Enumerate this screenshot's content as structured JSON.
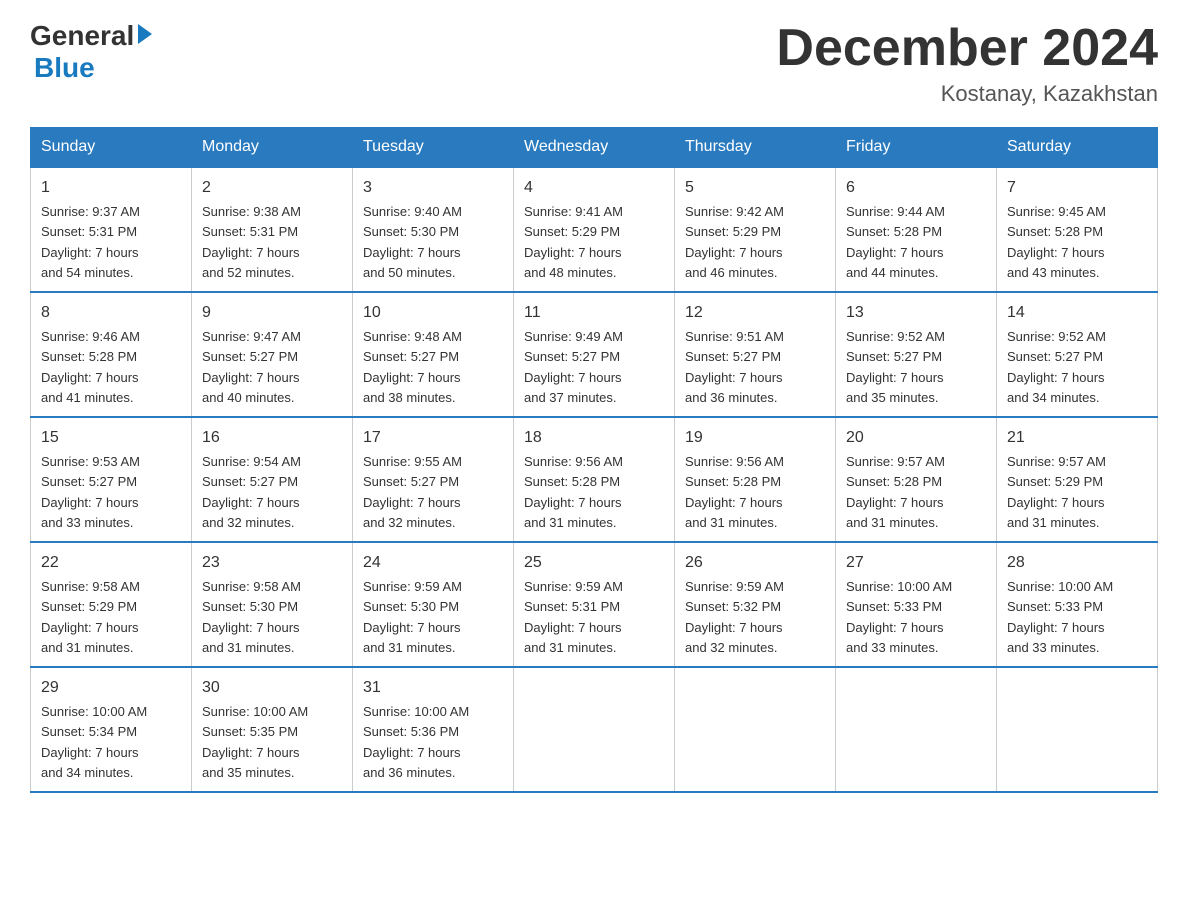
{
  "header": {
    "logo_general": "General",
    "logo_blue": "Blue",
    "month_title": "December 2024",
    "location": "Kostanay, Kazakhstan"
  },
  "days_of_week": [
    "Sunday",
    "Monday",
    "Tuesday",
    "Wednesday",
    "Thursday",
    "Friday",
    "Saturday"
  ],
  "weeks": [
    [
      {
        "day": "1",
        "sunrise": "9:37 AM",
        "sunset": "5:31 PM",
        "daylight": "7 hours and 54 minutes."
      },
      {
        "day": "2",
        "sunrise": "9:38 AM",
        "sunset": "5:31 PM",
        "daylight": "7 hours and 52 minutes."
      },
      {
        "day": "3",
        "sunrise": "9:40 AM",
        "sunset": "5:30 PM",
        "daylight": "7 hours and 50 minutes."
      },
      {
        "day": "4",
        "sunrise": "9:41 AM",
        "sunset": "5:29 PM",
        "daylight": "7 hours and 48 minutes."
      },
      {
        "day": "5",
        "sunrise": "9:42 AM",
        "sunset": "5:29 PM",
        "daylight": "7 hours and 46 minutes."
      },
      {
        "day": "6",
        "sunrise": "9:44 AM",
        "sunset": "5:28 PM",
        "daylight": "7 hours and 44 minutes."
      },
      {
        "day": "7",
        "sunrise": "9:45 AM",
        "sunset": "5:28 PM",
        "daylight": "7 hours and 43 minutes."
      }
    ],
    [
      {
        "day": "8",
        "sunrise": "9:46 AM",
        "sunset": "5:28 PM",
        "daylight": "7 hours and 41 minutes."
      },
      {
        "day": "9",
        "sunrise": "9:47 AM",
        "sunset": "5:27 PM",
        "daylight": "7 hours and 40 minutes."
      },
      {
        "day": "10",
        "sunrise": "9:48 AM",
        "sunset": "5:27 PM",
        "daylight": "7 hours and 38 minutes."
      },
      {
        "day": "11",
        "sunrise": "9:49 AM",
        "sunset": "5:27 PM",
        "daylight": "7 hours and 37 minutes."
      },
      {
        "day": "12",
        "sunrise": "9:51 AM",
        "sunset": "5:27 PM",
        "daylight": "7 hours and 36 minutes."
      },
      {
        "day": "13",
        "sunrise": "9:52 AM",
        "sunset": "5:27 PM",
        "daylight": "7 hours and 35 minutes."
      },
      {
        "day": "14",
        "sunrise": "9:52 AM",
        "sunset": "5:27 PM",
        "daylight": "7 hours and 34 minutes."
      }
    ],
    [
      {
        "day": "15",
        "sunrise": "9:53 AM",
        "sunset": "5:27 PM",
        "daylight": "7 hours and 33 minutes."
      },
      {
        "day": "16",
        "sunrise": "9:54 AM",
        "sunset": "5:27 PM",
        "daylight": "7 hours and 32 minutes."
      },
      {
        "day": "17",
        "sunrise": "9:55 AM",
        "sunset": "5:27 PM",
        "daylight": "7 hours and 32 minutes."
      },
      {
        "day": "18",
        "sunrise": "9:56 AM",
        "sunset": "5:28 PM",
        "daylight": "7 hours and 31 minutes."
      },
      {
        "day": "19",
        "sunrise": "9:56 AM",
        "sunset": "5:28 PM",
        "daylight": "7 hours and 31 minutes."
      },
      {
        "day": "20",
        "sunrise": "9:57 AM",
        "sunset": "5:28 PM",
        "daylight": "7 hours and 31 minutes."
      },
      {
        "day": "21",
        "sunrise": "9:57 AM",
        "sunset": "5:29 PM",
        "daylight": "7 hours and 31 minutes."
      }
    ],
    [
      {
        "day": "22",
        "sunrise": "9:58 AM",
        "sunset": "5:29 PM",
        "daylight": "7 hours and 31 minutes."
      },
      {
        "day": "23",
        "sunrise": "9:58 AM",
        "sunset": "5:30 PM",
        "daylight": "7 hours and 31 minutes."
      },
      {
        "day": "24",
        "sunrise": "9:59 AM",
        "sunset": "5:30 PM",
        "daylight": "7 hours and 31 minutes."
      },
      {
        "day": "25",
        "sunrise": "9:59 AM",
        "sunset": "5:31 PM",
        "daylight": "7 hours and 31 minutes."
      },
      {
        "day": "26",
        "sunrise": "9:59 AM",
        "sunset": "5:32 PM",
        "daylight": "7 hours and 32 minutes."
      },
      {
        "day": "27",
        "sunrise": "10:00 AM",
        "sunset": "5:33 PM",
        "daylight": "7 hours and 33 minutes."
      },
      {
        "day": "28",
        "sunrise": "10:00 AM",
        "sunset": "5:33 PM",
        "daylight": "7 hours and 33 minutes."
      }
    ],
    [
      {
        "day": "29",
        "sunrise": "10:00 AM",
        "sunset": "5:34 PM",
        "daylight": "7 hours and 34 minutes."
      },
      {
        "day": "30",
        "sunrise": "10:00 AM",
        "sunset": "5:35 PM",
        "daylight": "7 hours and 35 minutes."
      },
      {
        "day": "31",
        "sunrise": "10:00 AM",
        "sunset": "5:36 PM",
        "daylight": "7 hours and 36 minutes."
      },
      null,
      null,
      null,
      null
    ]
  ]
}
